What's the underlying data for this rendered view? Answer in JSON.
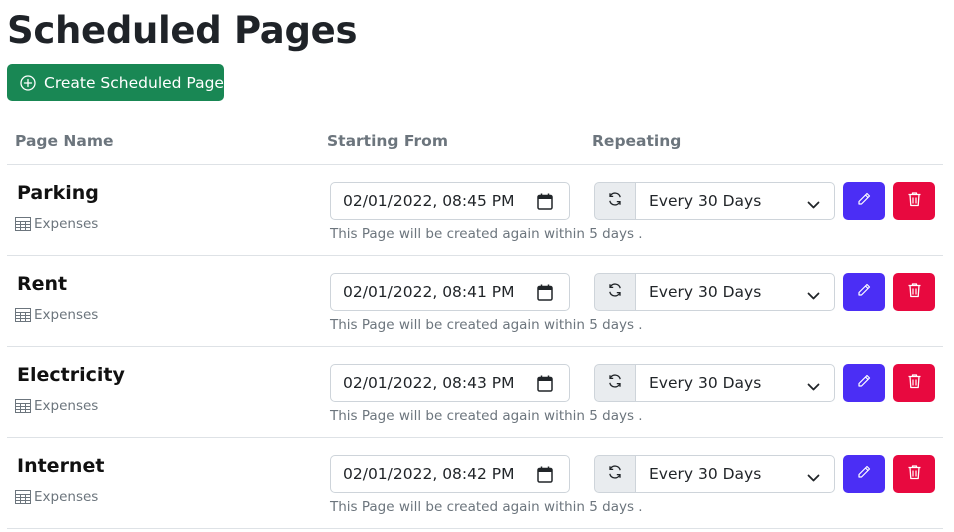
{
  "page": {
    "title": "Scheduled Pages",
    "create_button_label": "Create Scheduled Page"
  },
  "table": {
    "headers": [
      "Page Name",
      "Starting From",
      "Repeating"
    ],
    "rows": [
      {
        "name": "Parking",
        "database": "Expenses",
        "starting_from": "02/01/2022, 08:45 PM",
        "hint": "This Page will be created again within 5 days .",
        "repeating": "Every 30 Days"
      },
      {
        "name": "Rent",
        "database": "Expenses",
        "starting_from": "02/01/2022, 08:41 PM",
        "hint": "This Page will be created again within 5 days .",
        "repeating": "Every 30 Days"
      },
      {
        "name": "Electricity",
        "database": "Expenses",
        "starting_from": "02/01/2022, 08:43 PM",
        "hint": "This Page will be created again within 5 days .",
        "repeating": "Every 30 Days"
      },
      {
        "name": "Internet",
        "database": "Expenses",
        "starting_from": "02/01/2022, 08:42 PM",
        "hint": "This Page will be created again within 5 days .",
        "repeating": "Every 30 Days"
      }
    ]
  },
  "icons": {
    "create": "plus-circle-icon",
    "database": "table-icon",
    "date": "calendar-icon",
    "refresh": "refresh-icon",
    "select": "chevron-down-icon",
    "edit": "pencil-icon",
    "delete": "trash-icon"
  },
  "colors": {
    "create_button": "#198754",
    "edit_button": "#4b2ef5",
    "delete_button": "#e8093f",
    "muted_text": "#6c757d"
  }
}
